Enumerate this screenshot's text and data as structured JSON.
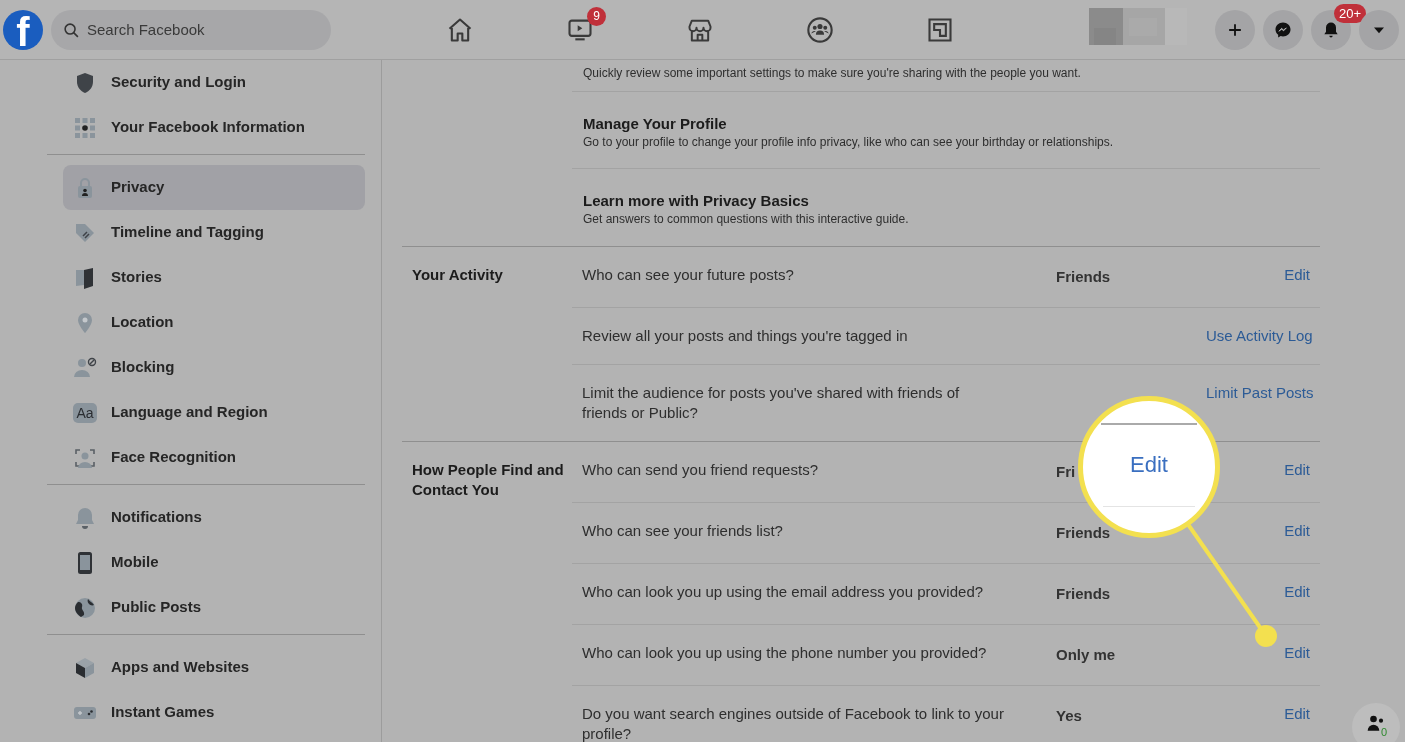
{
  "header": {
    "logo": "f",
    "search": {
      "placeholder": "Search Facebook"
    },
    "nav": [
      {
        "kind": "home"
      },
      {
        "kind": "video",
        "badge": "9"
      },
      {
        "kind": "store"
      },
      {
        "kind": "groups"
      },
      {
        "kind": "gaming"
      }
    ],
    "actions": [
      {
        "kind": "plus"
      },
      {
        "kind": "messenger"
      },
      {
        "kind": "bell",
        "badge": "20+"
      },
      {
        "kind": "caret"
      }
    ]
  },
  "sidebar": {
    "groups": [
      [
        {
          "label": "Security and Login",
          "kind": "shield",
          "selected": false
        },
        {
          "label": "Your Facebook Information",
          "kind": "grid",
          "selected": false
        }
      ],
      [
        {
          "label": "Privacy",
          "kind": "lock",
          "selected": true
        },
        {
          "label": "Timeline and Tagging",
          "kind": "tag",
          "selected": false
        },
        {
          "label": "Stories",
          "kind": "book",
          "selected": false
        },
        {
          "label": "Location",
          "kind": "pin",
          "selected": false
        },
        {
          "label": "Blocking",
          "kind": "block",
          "selected": false
        },
        {
          "label": "Language and Region",
          "kind": "glyph",
          "glyph": "Aa",
          "selected": false
        },
        {
          "label": "Face Recognition",
          "kind": "face",
          "selected": false
        }
      ],
      [
        {
          "label": "Notifications",
          "kind": "bell",
          "selected": false
        },
        {
          "label": "Mobile",
          "kind": "phone",
          "selected": false
        },
        {
          "label": "Public Posts",
          "kind": "globe",
          "selected": false
        }
      ],
      [
        {
          "label": "Apps and Websites",
          "kind": "cube",
          "selected": false
        },
        {
          "label": "Instant Games",
          "kind": "gamepad",
          "selected": false
        }
      ]
    ]
  },
  "main": {
    "intro": "Quickly review some important settings to make sure you're sharing with the people you want.",
    "basics": [
      {
        "title": "Manage Your Profile",
        "description": "Go to your profile to change your profile info privacy, like who can see your birthday or relationships."
      },
      {
        "title": "Learn more with Privacy Basics",
        "description": "Get answers to common questions with this interactive guide."
      }
    ],
    "sections": [
      {
        "title": "Your Activity",
        "rows": [
          {
            "question": "Who can see your future posts?",
            "value": "Friends",
            "action": "Edit"
          },
          {
            "question": "Review all your posts and things you're tagged in",
            "action": "Use Activity Log"
          },
          {
            "question": "Limit the audience for posts you've shared with friends of friends or Public?",
            "action": "Limit Past Posts"
          }
        ]
      },
      {
        "title": "How People Find and Contact You",
        "rows": [
          {
            "question": "Who can send you friend requests?",
            "value": "Fri",
            "action": "Edit"
          },
          {
            "question": "Who can see your friends list?",
            "value": "Friends",
            "action": "Edit"
          },
          {
            "question": "Who can look you up using the email address you provided?",
            "value": "Friends",
            "action": "Edit"
          },
          {
            "question": "Who can look you up using the phone number you provided?",
            "value": "Only me",
            "action": "Edit"
          },
          {
            "question": "Do you want search engines outside of Facebook to link to your profile?",
            "value": "Yes",
            "action": "Edit"
          }
        ]
      }
    ]
  },
  "callout": {
    "text": "Edit"
  },
  "contacts_button": {
    "badge": "0"
  }
}
